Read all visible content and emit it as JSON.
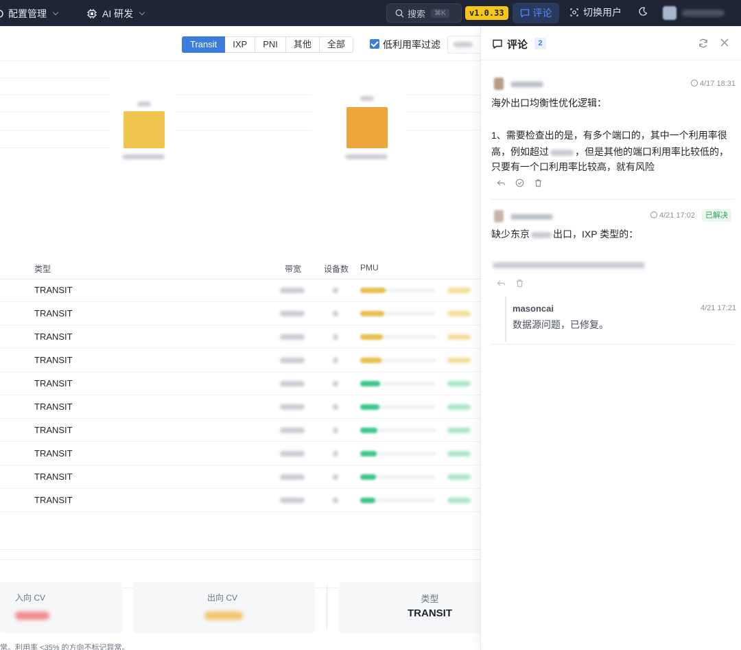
{
  "topbar": {
    "nav": [
      {
        "label": "配置管理",
        "icon": "settings-grid-icon"
      },
      {
        "label": "AI 研发",
        "icon": "chip-icon"
      }
    ],
    "search": {
      "label": "搜索",
      "shortcut": "⌘K"
    },
    "version": "v1.0.33",
    "comment_button": "评论",
    "switch_user": "切换用户"
  },
  "filters": {
    "tabs": [
      {
        "label": "Transit",
        "active": true
      },
      {
        "label": "IXP",
        "active": false
      },
      {
        "label": "PNI",
        "active": false
      },
      {
        "label": "其他",
        "active": false
      },
      {
        "label": "全部",
        "active": false
      }
    ],
    "low_util_filter": {
      "label": "低利用率过滤",
      "checked": true
    }
  },
  "table": {
    "columns": {
      "type": "类型",
      "bandwidth": "带宽",
      "devices": "设备数",
      "pmu": "PMU"
    },
    "rows": [
      {
        "type": "TRANSIT",
        "pmu_fraction": 0.34,
        "status": "warn"
      },
      {
        "type": "TRANSIT",
        "pmu_fraction": 0.32,
        "status": "warn"
      },
      {
        "type": "TRANSIT",
        "pmu_fraction": 0.3,
        "status": "warn"
      },
      {
        "type": "TRANSIT",
        "pmu_fraction": 0.28,
        "status": "warn"
      },
      {
        "type": "TRANSIT",
        "pmu_fraction": 0.26,
        "status": "ok"
      },
      {
        "type": "TRANSIT",
        "pmu_fraction": 0.25,
        "status": "ok"
      },
      {
        "type": "TRANSIT",
        "pmu_fraction": 0.23,
        "status": "ok"
      },
      {
        "type": "TRANSIT",
        "pmu_fraction": 0.22,
        "status": "ok"
      },
      {
        "type": "TRANSIT",
        "pmu_fraction": 0.21,
        "status": "ok"
      },
      {
        "type": "TRANSIT",
        "pmu_fraction": 0.2,
        "status": "ok"
      }
    ]
  },
  "summary": {
    "in_cv_label": "入向 CV",
    "out_cv_label": "出向 CV",
    "type_label": "类型",
    "type_value": "TRANSIT",
    "footnote": "常。利用率 <35% 的方向不标记异常。"
  },
  "comments_panel": {
    "title": "评论",
    "count": "2",
    "comments": [
      {
        "time": "4/17 18:31",
        "line1": "海外出口均衡性优化逻辑：",
        "line2": "1、需要检查出的是，有多个端口的，其中一个利用率很",
        "line3a": "高，例如超过",
        "line3b": "，但是其他的端口利用率比较低的，",
        "line4": "只要有一个口利用率比较高，就有风险"
      },
      {
        "time": "4/21 17:02",
        "status": "已解决",
        "line1a": "缺少东京",
        "line1b": "出口，IXP 类型的：",
        "reply": {
          "author": "masoncai",
          "time": "4/21 17:21",
          "text": "数据源问题，已修复。"
        }
      }
    ]
  },
  "colors": {
    "topbar_bg": "#1f2534",
    "accent": "#3b7ddd",
    "version_badge": "#f5c518",
    "warn": "#e8c04a",
    "ok": "#3cc88a",
    "bar_yellow": "#eec44e",
    "bar_orange": "#eda63c",
    "resolved": "#2e9e5b"
  }
}
